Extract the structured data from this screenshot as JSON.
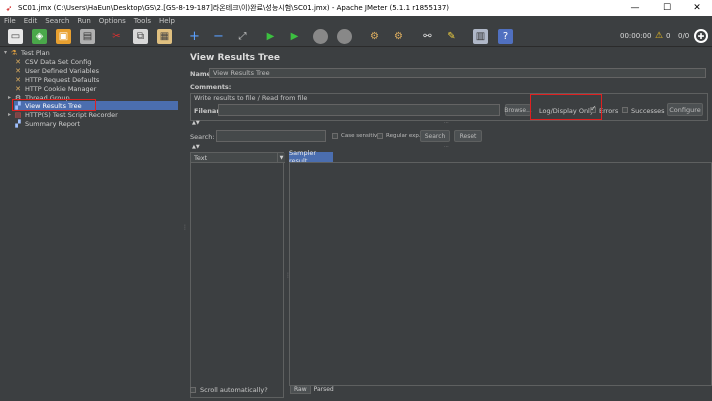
{
  "window": {
    "title": "SC01.jmx (C:\\Users\\HaEun\\Desktop\\GS\\2.[GS-8-19-187]라온테크\\이)완료\\성능시험\\SC01.jmx) - Apache JMeter (5.1.1 r1855137)",
    "minimize": "—",
    "maximize": "☐",
    "close": "✕"
  },
  "menu": [
    "File",
    "Edit",
    "Search",
    "Run",
    "Options",
    "Tools",
    "Help"
  ],
  "toolbar": {
    "timer": "00:00:00",
    "warning_count": "0",
    "threads": "0/0"
  },
  "tree": {
    "items": [
      {
        "label": "Test Plan"
      },
      {
        "label": "CSV Data Set Config"
      },
      {
        "label": "User Defined Variables"
      },
      {
        "label": "HTTP Request Defaults"
      },
      {
        "label": "HTTP Cookie Manager"
      },
      {
        "label": "Thread Group"
      },
      {
        "label": "View Results Tree"
      },
      {
        "label": "HTTP(S) Test Script Recorder"
      },
      {
        "label": "Summary Report"
      }
    ]
  },
  "panel": {
    "title": "View Results Tree",
    "name_label": "Name:",
    "name_value": "View Results Tree",
    "comments_label": "Comments:",
    "write_group_title": "Write results to file / Read from file",
    "filename_label": "Filename",
    "browse_label": "Browse...",
    "log_display_label": "Log/Display Only:",
    "errors_label": "Errors",
    "successes_label": "Successes",
    "configure_label": "Configure",
    "search_label": "Search:",
    "case_sensitive_label": "Case sensitive",
    "regular_exp_label": "Regular exp.",
    "search_button": "Search",
    "reset_button": "Reset",
    "renderer_value": "Text",
    "sampler_result_tab": "Sampler result",
    "scroll_auto_label": "Scroll automatically?",
    "raw_tab": "Raw",
    "parsed_tab": "Parsed"
  }
}
